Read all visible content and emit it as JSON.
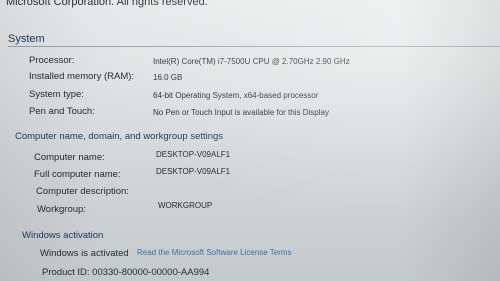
{
  "header": {
    "copyright": "Microsoft Corporation. All rights reserved."
  },
  "system": {
    "title": "System",
    "rows": [
      {
        "label": "Processor:",
        "value": "Intel(R) Core(TM) i7-7500U CPU @ 2.70GHz  2.90 GHz"
      },
      {
        "label": "Installed memory (RAM):",
        "value": "16.0 GB"
      },
      {
        "label": "System type:",
        "value": "64-bit Operating System, x64-based processor"
      },
      {
        "label": "Pen and Touch:",
        "value": "No Pen or Touch Input is available for this Display"
      }
    ]
  },
  "computer": {
    "title": "Computer name, domain, and workgroup settings",
    "rows": [
      {
        "label": "Computer name:",
        "value": "DESKTOP-V09ALF1"
      },
      {
        "label": "Full computer name:",
        "value": "DESKTOP-V09ALF1"
      },
      {
        "label": "Computer description:",
        "value": ""
      },
      {
        "label": "Workgroup:",
        "value": "WORKGROUP"
      }
    ]
  },
  "activation": {
    "title": "Windows activation",
    "status": "Windows is activated",
    "license_link": "Read the Microsoft Software License Terms",
    "product_id": "Product ID: 00330-80000-00000-AA994"
  }
}
